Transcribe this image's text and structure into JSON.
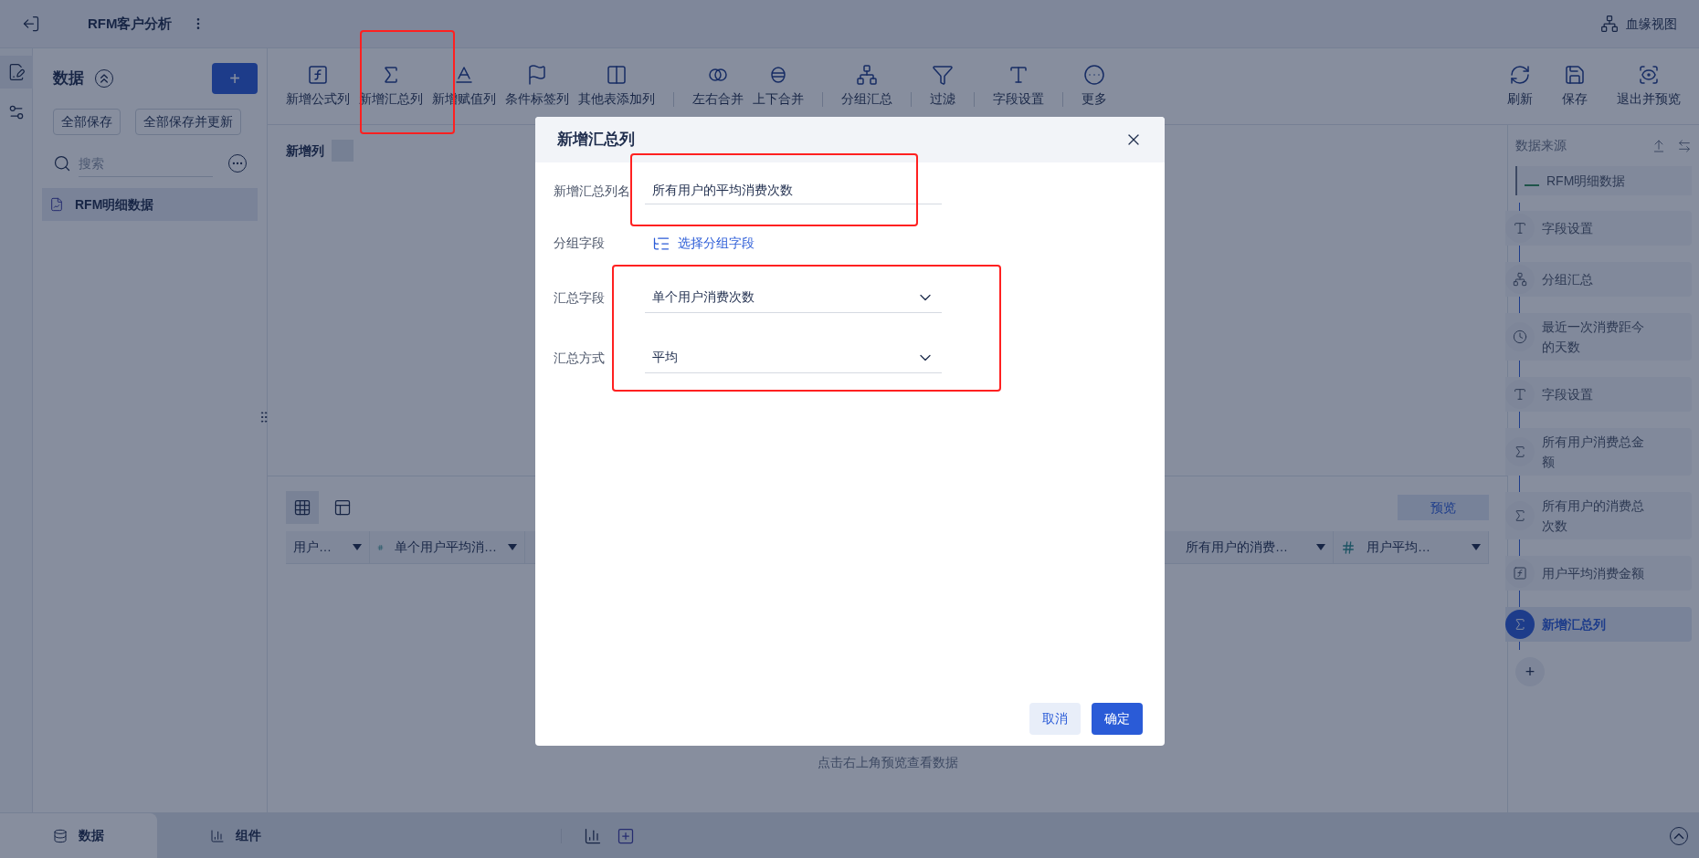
{
  "title_bar": {
    "title": "RFM客户分析",
    "lineage_link": "血缘视图"
  },
  "left_panel": {
    "title": "数据",
    "add_button": "+",
    "buttons": [
      "全部保存",
      "全部保存并更新"
    ],
    "search": {
      "placeholder": "搜索"
    },
    "items": [
      {
        "label": "RFM明细数据",
        "selected": true
      }
    ]
  },
  "toolbar": {
    "groups": [
      [
        {
          "kind": "formula",
          "label": "新增公式列"
        },
        {
          "kind": "sum",
          "label": "新增汇总列"
        },
        {
          "kind": "assign",
          "label": "新增赋值列"
        },
        {
          "kind": "flag",
          "label": "条件标签列"
        },
        {
          "kind": "addcol",
          "label": "其他表添加列"
        }
      ],
      [
        {
          "kind": "lr",
          "label": "左右合并"
        },
        {
          "kind": "ud",
          "label": "上下合并"
        }
      ],
      [
        {
          "kind": "group",
          "label": "分组汇总"
        }
      ],
      [
        {
          "kind": "filter",
          "label": "过滤"
        }
      ],
      [
        {
          "kind": "field",
          "label": "字段设置"
        }
      ],
      [
        {
          "kind": "more",
          "label": "更多"
        }
      ]
    ],
    "right": [
      {
        "kind": "refresh",
        "label": "刷新"
      },
      {
        "kind": "save",
        "label": "保存"
      },
      {
        "kind": "exit",
        "label": "退出并预览"
      }
    ]
  },
  "editor": {
    "label": "新增列"
  },
  "preview": {
    "views": [
      {
        "kind": "grid",
        "selected": true
      },
      {
        "kind": "layout",
        "selected": false
      }
    ],
    "preview_button": "预览",
    "columns": [
      {
        "label": "用户…",
        "numeric": false
      },
      {
        "label": "单个用户平均消…",
        "numeric": true
      },
      {
        "label": "所有用户的消费…",
        "numeric": false
      },
      {
        "label": "用户平均…",
        "numeric": true
      }
    ],
    "hint": "点击右上角预览查看数据"
  },
  "steps_panel": {
    "title": "数据来源",
    "source": "RFM明细数据",
    "add": "+",
    "steps": [
      {
        "kind": "field",
        "label": "字段设置",
        "selected": false
      },
      {
        "kind": "group",
        "label": "分组汇总",
        "selected": false
      },
      {
        "kind": "clock",
        "label": "最近一次消费距今的天数",
        "selected": false
      },
      {
        "kind": "field",
        "label": "字段设置",
        "selected": false
      },
      {
        "kind": "sum",
        "label": "所有用户消费总金额",
        "selected": false
      },
      {
        "kind": "sum",
        "label": "所有用户的消费总次数",
        "selected": false
      },
      {
        "kind": "formula",
        "label": "用户平均消费金额",
        "selected": false
      },
      {
        "kind": "sum",
        "label": "新增汇总列",
        "selected": true
      }
    ]
  },
  "bottom_tabs": [
    {
      "label": "数据",
      "kind": "data",
      "selected": true
    },
    {
      "label": "组件",
      "kind": "component",
      "selected": false
    }
  ],
  "dialog": {
    "title": "新增汇总列",
    "fields": [
      {
        "kind": "input",
        "label": "新增汇总列名",
        "value": "所有用户的平均消费次数"
      },
      {
        "kind": "link",
        "label": "分组字段",
        "value": "选择分组字段"
      },
      {
        "kind": "select",
        "label": "汇总字段",
        "value": "单个用户消费次数"
      },
      {
        "kind": "select",
        "label": "汇总方式",
        "value": "平均"
      }
    ],
    "buttons": [
      {
        "label": "取消",
        "primary": false
      },
      {
        "label": "确定",
        "primary": true
      }
    ]
  }
}
